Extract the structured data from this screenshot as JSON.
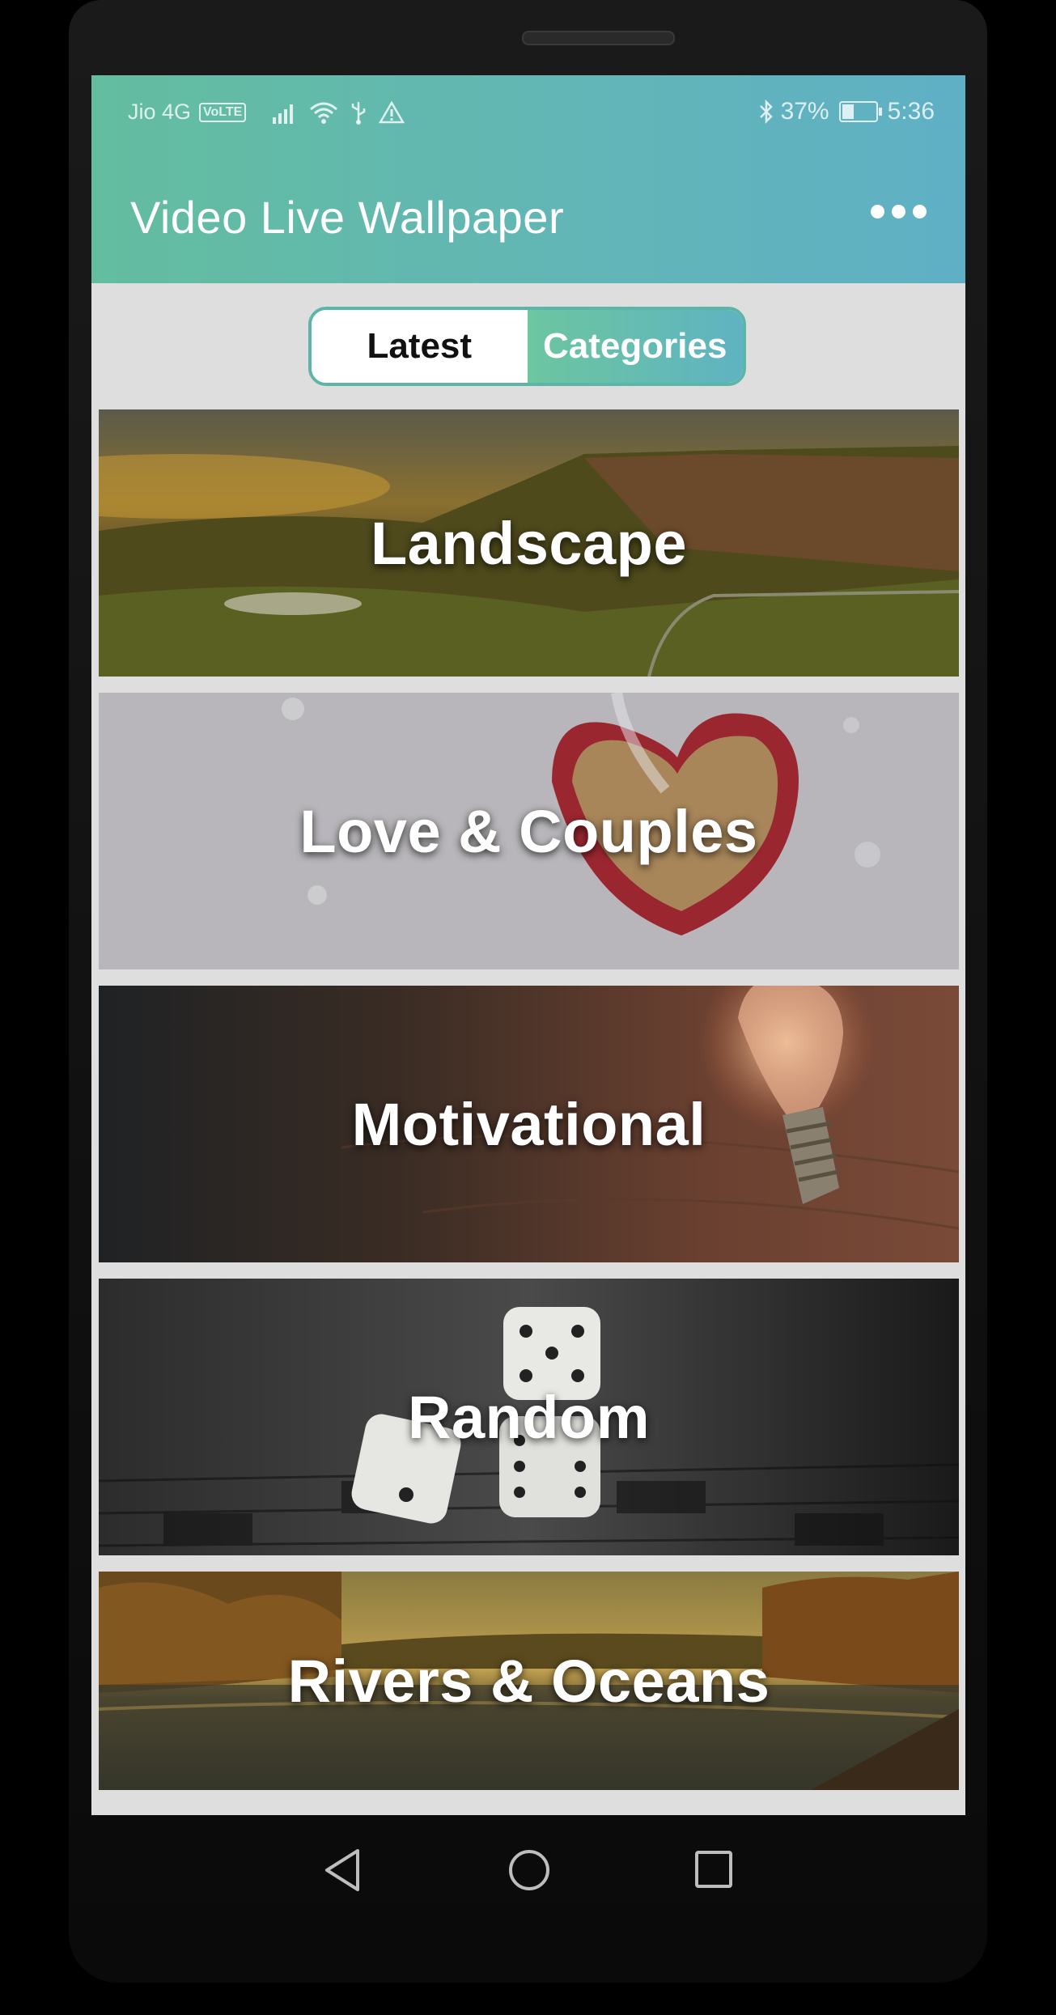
{
  "status_bar": {
    "carrier": "Jio 4G",
    "volte": "VoLTE",
    "battery_percent": "37%",
    "battery_level": 0.37,
    "time": "5:36",
    "icons": [
      "signal-icon",
      "wifi-icon",
      "usb-icon",
      "warning-icon",
      "bluetooth-icon",
      "battery-icon"
    ]
  },
  "app_bar": {
    "title": "Video Live Wallpaper",
    "menu_icon": "more-options-icon"
  },
  "tabs": {
    "latest": "Latest",
    "categories": "Categories",
    "selected": "Categories"
  },
  "categories": [
    {
      "label": "Landscape"
    },
    {
      "label": "Love & Couples"
    },
    {
      "label": "Motivational"
    },
    {
      "label": "Random"
    },
    {
      "label": "Rivers & Oceans"
    }
  ],
  "nav_bar": {
    "back_icon": "back-triangle-icon",
    "home_icon": "home-circle-icon",
    "recents_icon": "recents-square-icon"
  },
  "colors": {
    "appbar_start": "#63bd9f",
    "appbar_end": "#5fb0c5",
    "tab_border": "#5cb5a6",
    "screen_bg": "#dedede"
  }
}
